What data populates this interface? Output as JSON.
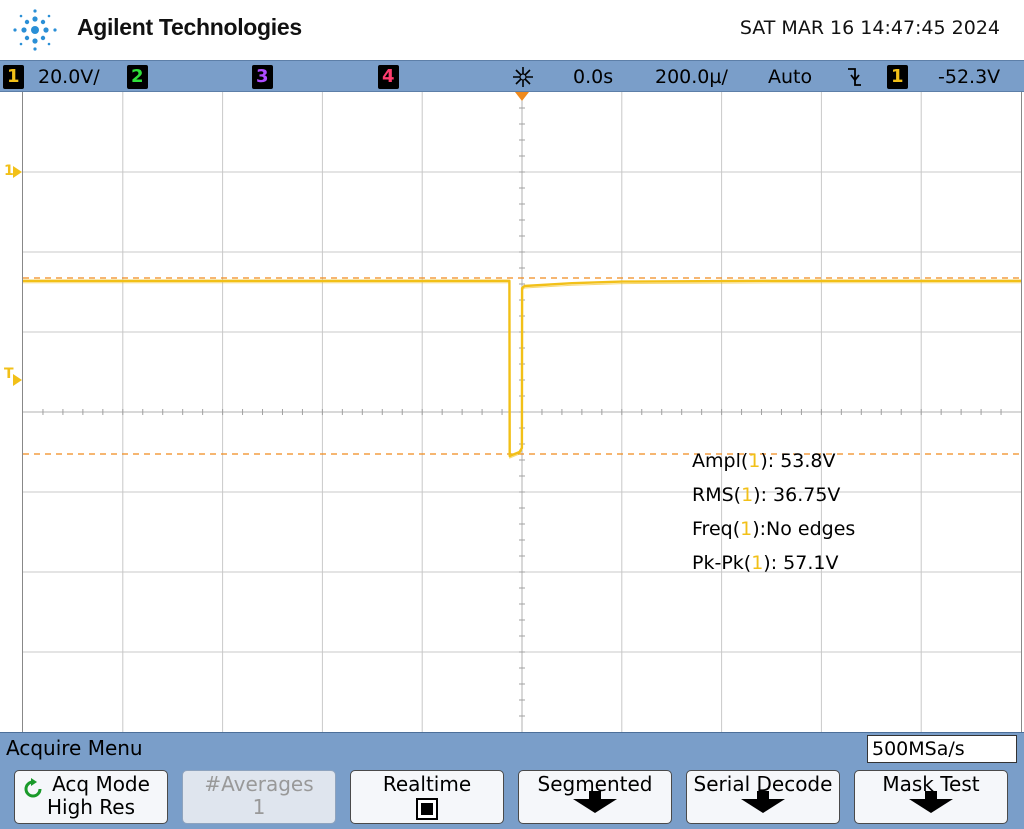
{
  "header": {
    "brand": "Agilent Technologies",
    "datetime": "SAT MAR 16 14:47:45 2024"
  },
  "status_bar": {
    "ch1_num": "1",
    "ch1_scale": "20.0V/",
    "ch2_num": "2",
    "ch3_num": "3",
    "ch4_num": "4",
    "time_delay": "0.0s",
    "time_scale": "200.0µ/",
    "trigger_mode": "Auto",
    "trigger_source_num": "1",
    "trigger_level": "-52.3V"
  },
  "colors": {
    "ch1": "#f2c018",
    "ch2": "#2fe03a",
    "ch3": "#b04cff",
    "ch4": "#ff3c6e",
    "cursor": "#f08a1c",
    "bar": "#7a9ec9"
  },
  "display": {
    "ch1_marker": "1",
    "trigger_marker": "T"
  },
  "measurements": [
    {
      "name": "Ampl(",
      "ch": "1",
      "sep": "): ",
      "value": "53.8V"
    },
    {
      "name": "RMS(",
      "ch": "1",
      "sep": "): ",
      "value": "36.75V"
    },
    {
      "name": "Freq(",
      "ch": "1",
      "sep": "):",
      "value": "No edges"
    },
    {
      "name": "Pk-Pk(",
      "ch": "1",
      "sep": "): ",
      "value": "57.1V"
    }
  ],
  "chart_data": {
    "type": "line",
    "series": [
      {
        "x": [
          -1.0,
          -0.5,
          -0.25,
          -0.0253,
          -0.0247,
          -0.005,
          -0.0003,
          0.0003,
          0.005,
          0.1,
          0.2,
          0.5,
          1.0
        ],
        "y": [
          32.8,
          32.8,
          32.8,
          32.8,
          -11.0,
          -10.0,
          -9.0,
          31.0,
          31.5,
          32.2,
          32.6,
          32.8,
          32.8
        ]
      }
    ],
    "xlim": [
      -1.0,
      1.0
    ],
    "ylim": [
      -80,
      80
    ],
    "cursor_levels": [
      33.5,
      -10.5
    ],
    "grid": true
  },
  "menu": {
    "title": "Acquire Menu",
    "sample_rate": "500MSa/s",
    "softkeys": [
      {
        "line1": "Acq Mode",
        "line2": "High Res",
        "icon": "rotate-arrow-icon"
      },
      {
        "line1": "#Averages",
        "line2": "1"
      },
      {
        "line1": "Realtime",
        "icon": "checkbox-icon"
      },
      {
        "line1": "Segmented",
        "icon": "down-arrow-icon"
      },
      {
        "line1": "Serial Decode",
        "icon": "down-arrow-icon"
      },
      {
        "line1": "Mask Test",
        "icon": "down-arrow-icon"
      }
    ]
  }
}
